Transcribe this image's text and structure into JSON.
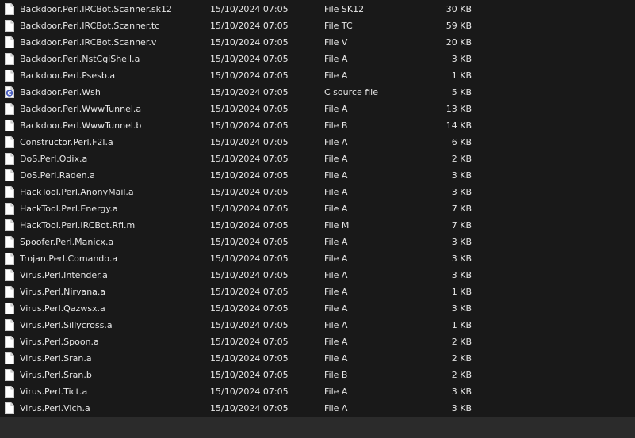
{
  "files": [
    {
      "name": "Backdoor.Perl.IRCBot.Scanner.sk12",
      "date": "15/10/2024 07:05",
      "type": "File SK12",
      "size": "30 KB",
      "icon": "blank-file-icon"
    },
    {
      "name": "Backdoor.Perl.IRCBot.Scanner.tc",
      "date": "15/10/2024 07:05",
      "type": "File TC",
      "size": "59 KB",
      "icon": "blank-file-icon"
    },
    {
      "name": "Backdoor.Perl.IRCBot.Scanner.v",
      "date": "15/10/2024 07:05",
      "type": "File V",
      "size": "20 KB",
      "icon": "blank-file-icon"
    },
    {
      "name": "Backdoor.Perl.NstCgiShell.a",
      "date": "15/10/2024 07:05",
      "type": "File A",
      "size": "3 KB",
      "icon": "blank-file-icon"
    },
    {
      "name": "Backdoor.Perl.Psesb.a",
      "date": "15/10/2024 07:05",
      "type": "File A",
      "size": "1 KB",
      "icon": "blank-file-icon"
    },
    {
      "name": "Backdoor.Perl.Wsh",
      "date": "15/10/2024 07:05",
      "type": "C source file",
      "size": "5 KB",
      "icon": "c-source-file-icon"
    },
    {
      "name": "Backdoor.Perl.WwwTunnel.a",
      "date": "15/10/2024 07:05",
      "type": "File A",
      "size": "13 KB",
      "icon": "blank-file-icon"
    },
    {
      "name": "Backdoor.Perl.WwwTunnel.b",
      "date": "15/10/2024 07:05",
      "type": "File B",
      "size": "14 KB",
      "icon": "blank-file-icon"
    },
    {
      "name": "Constructor.Perl.F2l.a",
      "date": "15/10/2024 07:05",
      "type": "File A",
      "size": "6 KB",
      "icon": "blank-file-icon"
    },
    {
      "name": "DoS.Perl.Odix.a",
      "date": "15/10/2024 07:05",
      "type": "File A",
      "size": "2 KB",
      "icon": "blank-file-icon"
    },
    {
      "name": "DoS.Perl.Raden.a",
      "date": "15/10/2024 07:05",
      "type": "File A",
      "size": "3 KB",
      "icon": "blank-file-icon"
    },
    {
      "name": "HackTool.Perl.AnonyMail.a",
      "date": "15/10/2024 07:05",
      "type": "File A",
      "size": "3 KB",
      "icon": "blank-file-icon"
    },
    {
      "name": "HackTool.Perl.Energy.a",
      "date": "15/10/2024 07:05",
      "type": "File A",
      "size": "7 KB",
      "icon": "blank-file-icon"
    },
    {
      "name": "HackTool.Perl.IRCBot.Rfi.m",
      "date": "15/10/2024 07:05",
      "type": "File M",
      "size": "7 KB",
      "icon": "blank-file-icon"
    },
    {
      "name": "Spoofer.Perl.Manicx.a",
      "date": "15/10/2024 07:05",
      "type": "File A",
      "size": "3 KB",
      "icon": "blank-file-icon"
    },
    {
      "name": "Trojan.Perl.Comando.a",
      "date": "15/10/2024 07:05",
      "type": "File A",
      "size": "3 KB",
      "icon": "blank-file-icon"
    },
    {
      "name": "Virus.Perl.Intender.a",
      "date": "15/10/2024 07:05",
      "type": "File A",
      "size": "3 KB",
      "icon": "blank-file-icon"
    },
    {
      "name": "Virus.Perl.Nirvana.a",
      "date": "15/10/2024 07:05",
      "type": "File A",
      "size": "1 KB",
      "icon": "blank-file-icon"
    },
    {
      "name": "Virus.Perl.Qazwsx.a",
      "date": "15/10/2024 07:05",
      "type": "File A",
      "size": "3 KB",
      "icon": "blank-file-icon"
    },
    {
      "name": "Virus.Perl.Sillycross.a",
      "date": "15/10/2024 07:05",
      "type": "File A",
      "size": "1 KB",
      "icon": "blank-file-icon"
    },
    {
      "name": "Virus.Perl.Spoon.a",
      "date": "15/10/2024 07:05",
      "type": "File A",
      "size": "2 KB",
      "icon": "blank-file-icon"
    },
    {
      "name": "Virus.Perl.Sran.a",
      "date": "15/10/2024 07:05",
      "type": "File A",
      "size": "2 KB",
      "icon": "blank-file-icon"
    },
    {
      "name": "Virus.Perl.Sran.b",
      "date": "15/10/2024 07:05",
      "type": "File B",
      "size": "2 KB",
      "icon": "blank-file-icon"
    },
    {
      "name": "Virus.Perl.Tict.a",
      "date": "15/10/2024 07:05",
      "type": "File A",
      "size": "3 KB",
      "icon": "blank-file-icon"
    },
    {
      "name": "Virus.Perl.Vich.a",
      "date": "15/10/2024 07:05",
      "type": "File A",
      "size": "3 KB",
      "icon": "blank-file-icon"
    }
  ],
  "colors": {
    "background": "#191919",
    "text": "#e6e6e6",
    "status_bar": "#2b2b2b",
    "c_icon_accent": "#4a5fc1"
  }
}
